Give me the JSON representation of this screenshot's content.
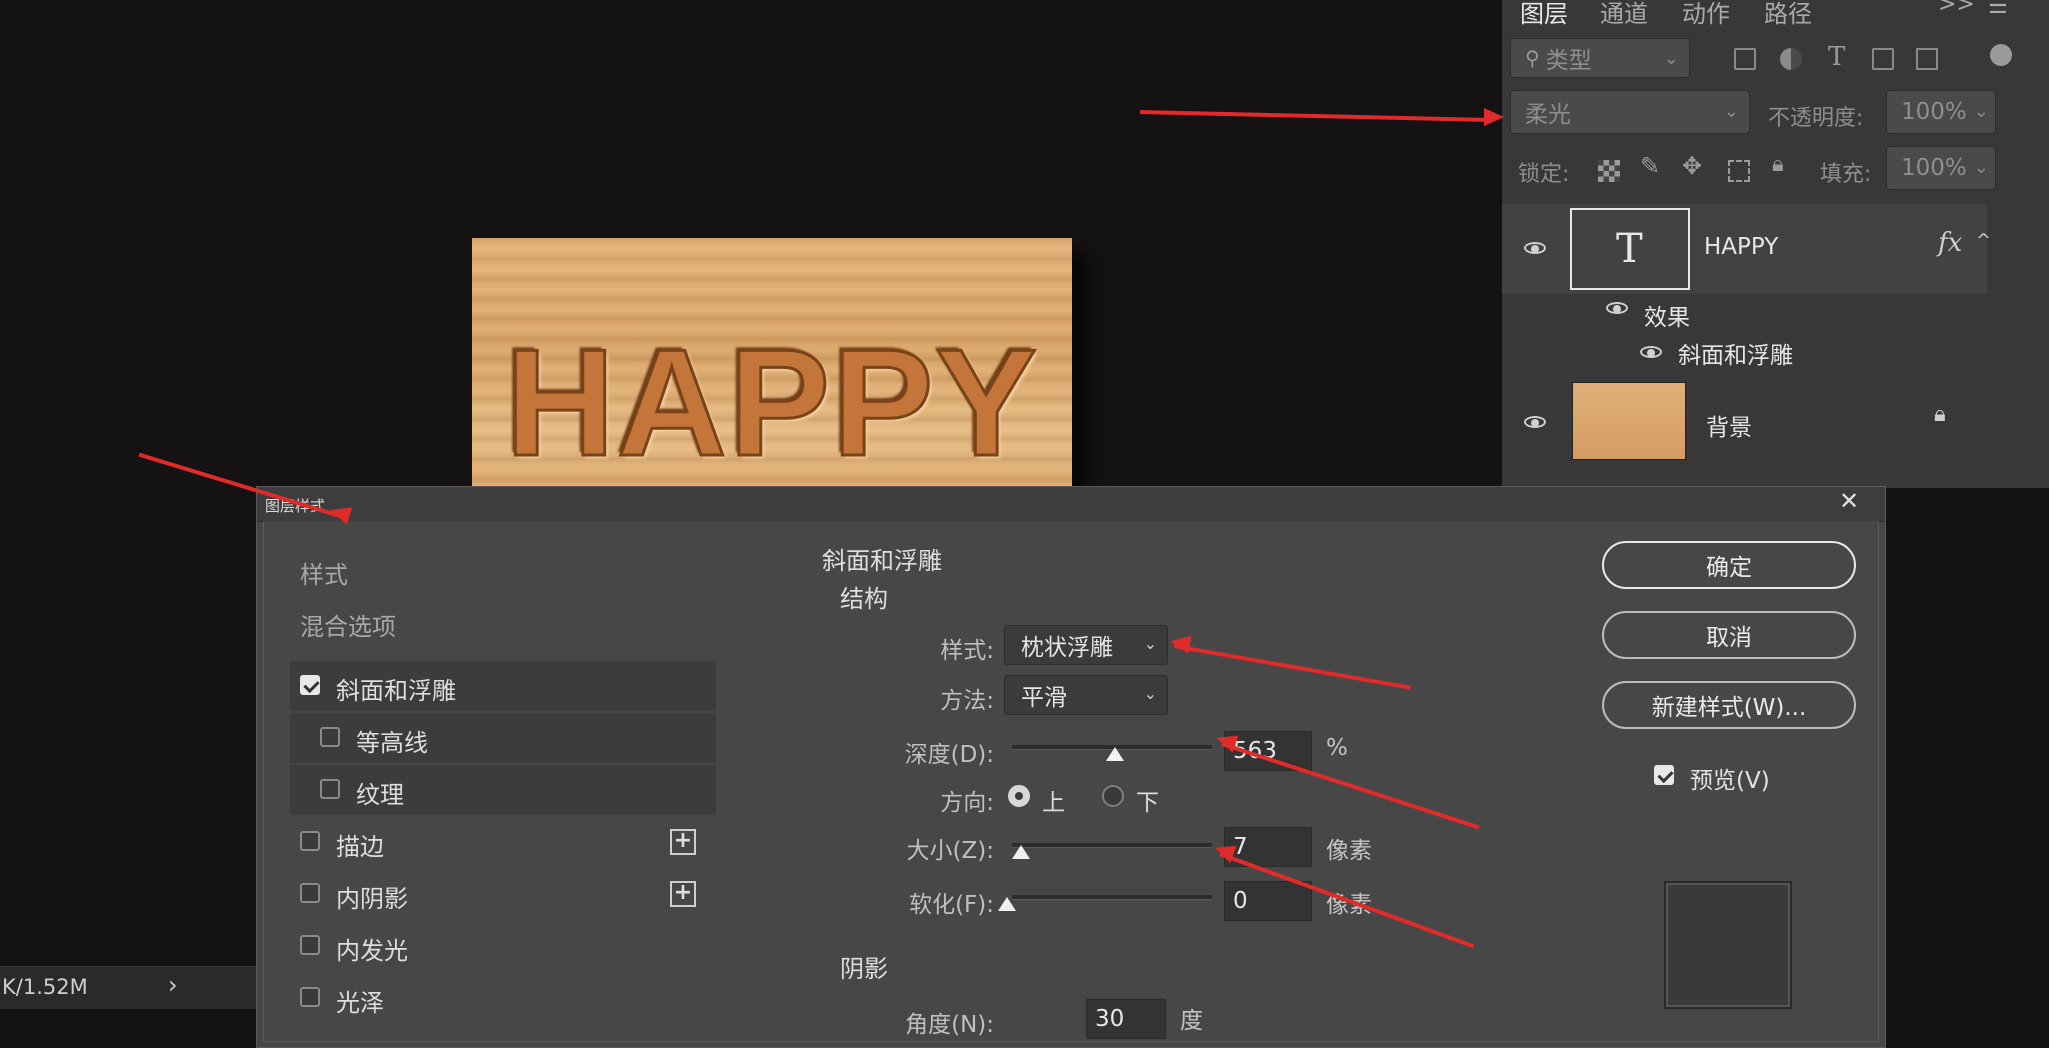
{
  "canvas": {
    "text": "HAPPY"
  },
  "layers_panel": {
    "tabs": [
      "图层",
      "通道",
      "动作",
      "路径"
    ],
    "expand_label": ">>",
    "filter_placeholder": "类型",
    "blend_mode": "柔光",
    "opacity_label": "不透明度:",
    "opacity_value": "100%",
    "lock_label": "锁定:",
    "fill_label": "填充:",
    "fill_value": "100%",
    "layers": [
      {
        "name": "HAPPY",
        "thumb_glyph": "T",
        "fx": "fx",
        "effects_label": "效果",
        "effect_item": "斜面和浮雕"
      },
      {
        "name": "背景"
      }
    ]
  },
  "dialog": {
    "title": "图层样式",
    "close": "✕",
    "left": {
      "styles_label": "样式",
      "blend_options": "混合选项",
      "items": [
        {
          "label": "斜面和浮雕",
          "checked": true
        },
        {
          "label": "等高线",
          "checked": false
        },
        {
          "label": "纹理",
          "checked": false
        },
        {
          "label": "描边",
          "checked": false,
          "plus": "+"
        },
        {
          "label": "内阴影",
          "checked": false,
          "plus": "+"
        },
        {
          "label": "内发光",
          "checked": false
        },
        {
          "label": "光泽",
          "checked": false
        }
      ]
    },
    "bevel": {
      "title": "斜面和浮雕",
      "structure": "结构",
      "style_label": "样式:",
      "style_value": "枕状浮雕",
      "technique_label": "方法:",
      "technique_value": "平滑",
      "depth_label": "深度(D):",
      "depth_value": "563",
      "depth_unit": "%",
      "direction_label": "方向:",
      "direction_up": "上",
      "direction_down": "下",
      "size_label": "大小(Z):",
      "size_value": "7",
      "size_unit": "像素",
      "soften_label": "软化(F):",
      "soften_value": "0",
      "soften_unit": "像素",
      "shading": "阴影",
      "angle_label": "角度(N):",
      "angle_value": "30",
      "angle_unit": "度"
    },
    "buttons": {
      "ok": "确定",
      "cancel": "取消",
      "new_style": "新建样式(W)...",
      "preview": "预览(V)"
    }
  },
  "statusbar": {
    "text": "K/1.52M",
    "arrow": "›"
  }
}
